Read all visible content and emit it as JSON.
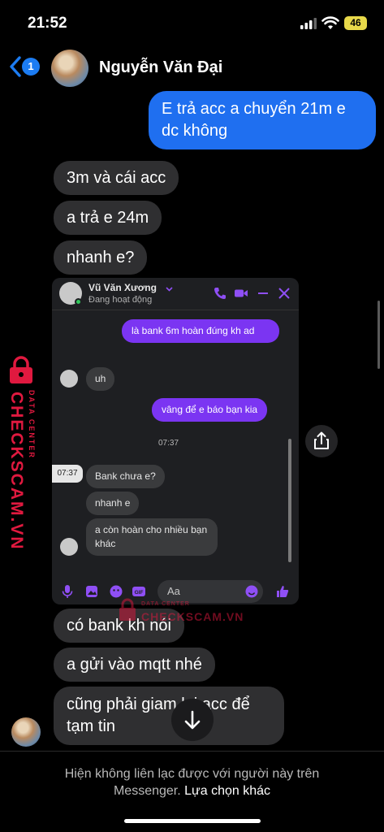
{
  "status_bar": {
    "time": "21:52",
    "battery": "46"
  },
  "header": {
    "back_badge": "1",
    "contact_name": "Nguyễn Văn Đại"
  },
  "messages": {
    "sent_1": "E trả acc a chuyển 21m e dc không",
    "recv_1": "3m và cái acc",
    "recv_2": "a trả e 24m",
    "recv_3": "nhanh e?",
    "recv_4": "có bank kh nói",
    "recv_5": "a gửi vào mqtt nhé",
    "recv_6": "cũng phải giam lại acc để tạm tin"
  },
  "embedded": {
    "contact_name": "Vũ Văn Xương",
    "status": "Đang hoạt động",
    "msg_out_1": "là bank 6m hoàn đúng kh ad",
    "msg_in_1": "uh",
    "msg_out_2": "vâng để e báo bạn kia",
    "time": "07:37",
    "tooltip": "07:37",
    "msg_in_2": "Bank chưa e?",
    "msg_in_3": "nhanh e",
    "msg_in_4": "a còn hoàn cho nhiều bạn khác",
    "input_placeholder": "Aa"
  },
  "watermark": {
    "brand": "CHECKSCAM.VN",
    "sub": "DATA CENTER"
  },
  "footer": {
    "notice": "Hiện không liên lạc được với người này trên Messenger.",
    "link": "Lựa chọn khác"
  },
  "colors": {
    "sent_bubble": "#1f6ff0",
    "received_bubble": "#2f2f31",
    "embedded_purple": "#7b35f2",
    "watermark": "#e0193f"
  }
}
